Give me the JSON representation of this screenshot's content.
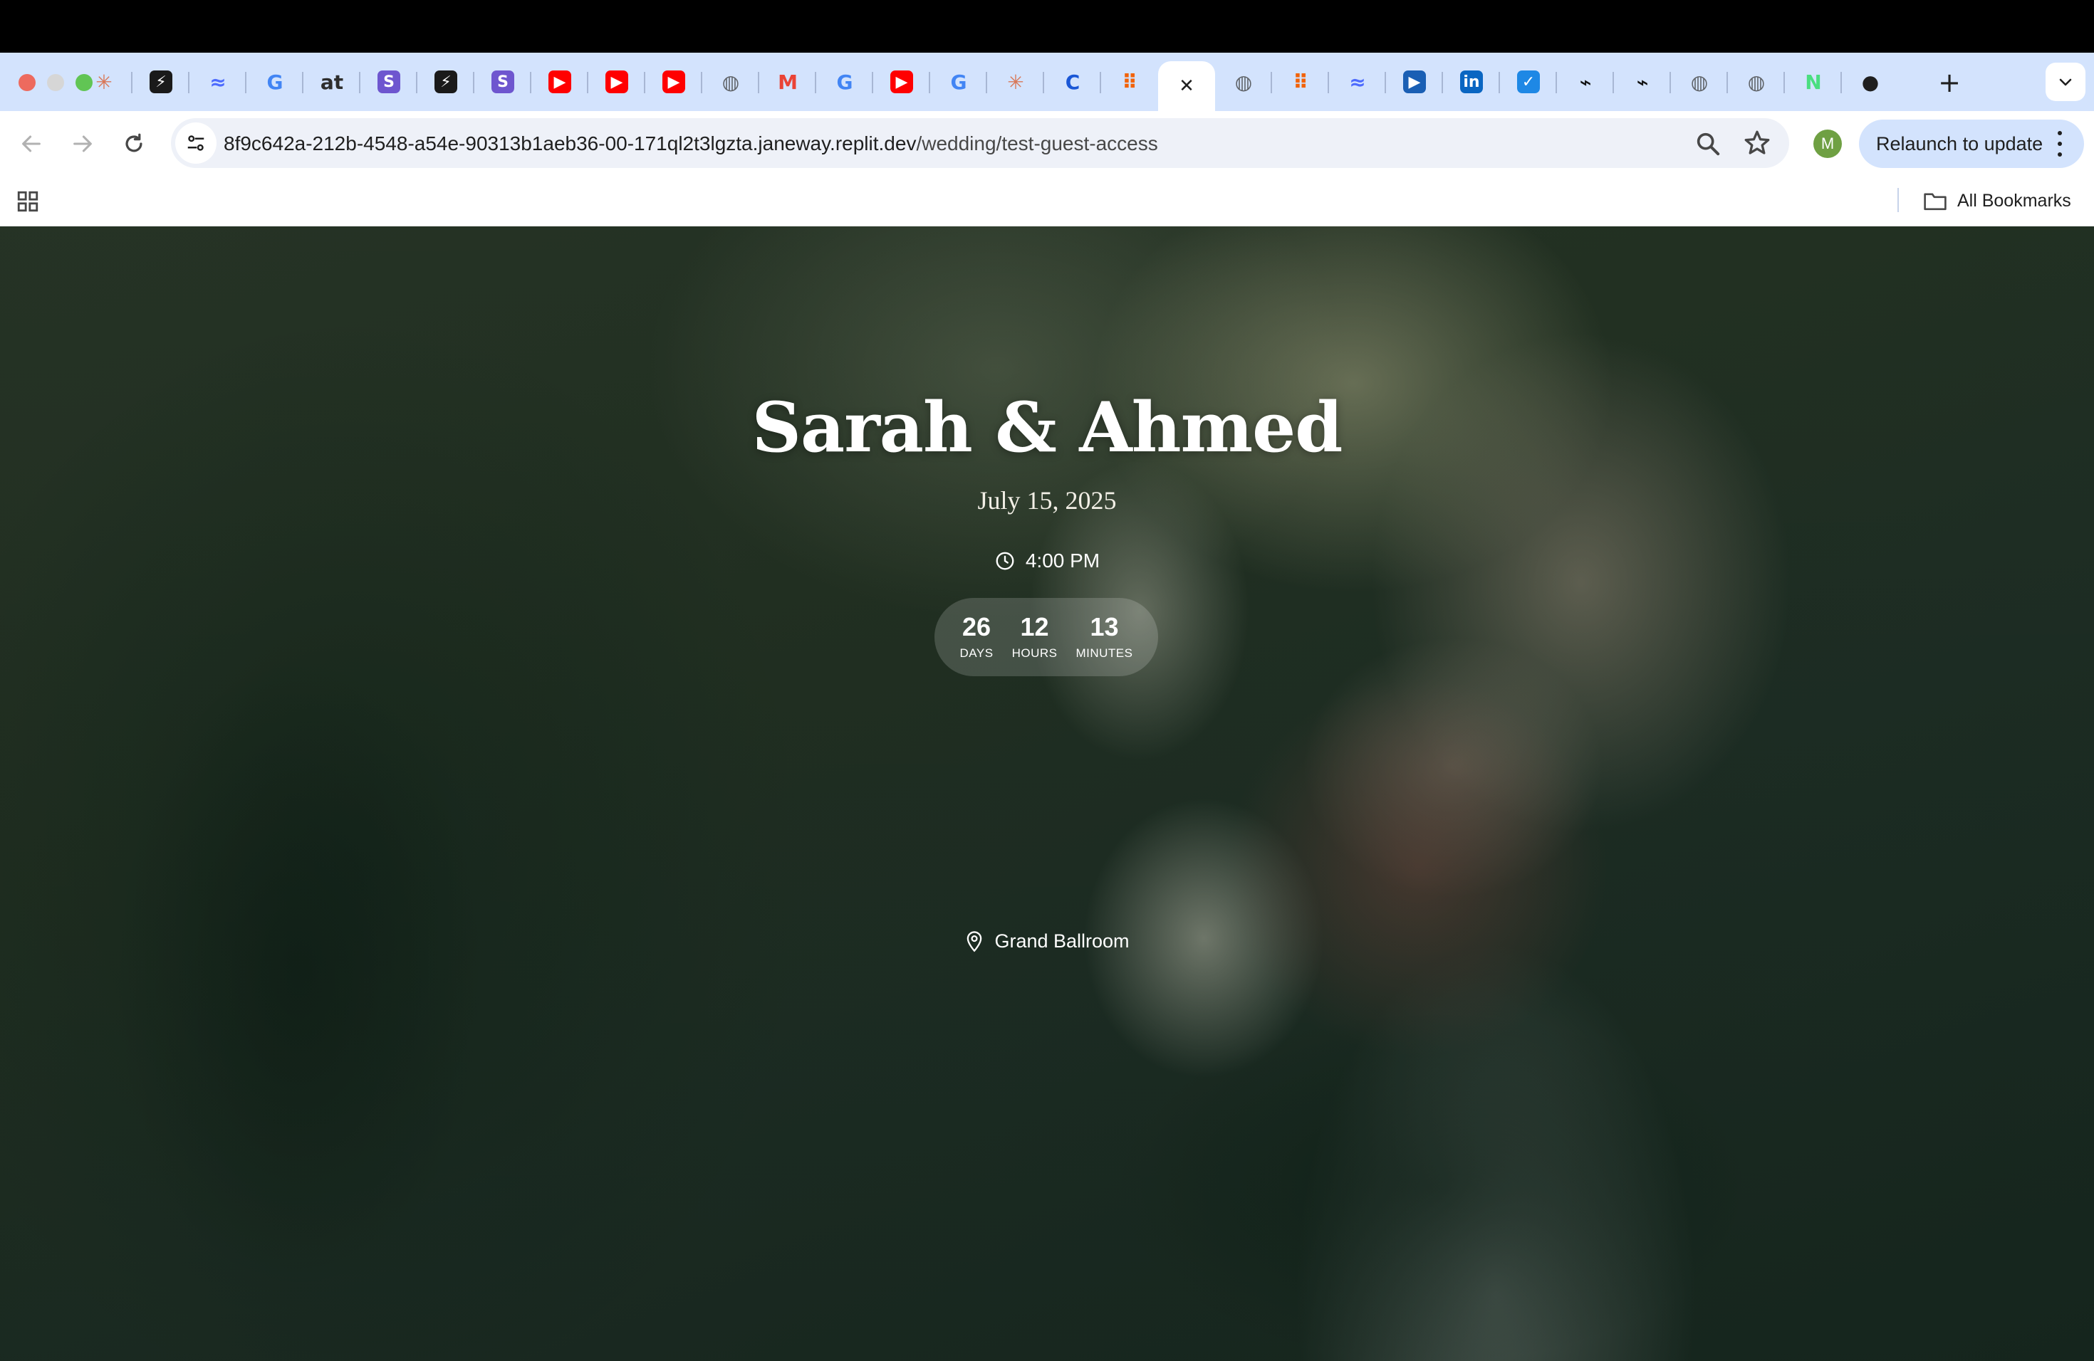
{
  "browser": {
    "tabs": [
      {
        "icon": "claude-icon",
        "color": "#d97757",
        "glyph": "✳"
      },
      {
        "icon": "bolt-icon",
        "color": "#1a1a1a",
        "glyph": "⚡"
      },
      {
        "icon": "deepseek-icon",
        "color": "#4d6bfe",
        "glyph": "≈"
      },
      {
        "icon": "google-icon",
        "color": "#4285f4",
        "glyph": "G"
      },
      {
        "icon": "at-icon",
        "color": "#2d2d2d",
        "glyph": "at"
      },
      {
        "icon": "s-icon",
        "color": "#6e56cf",
        "glyph": "S"
      },
      {
        "icon": "bolt-icon",
        "color": "#1a1a1a",
        "glyph": "⚡"
      },
      {
        "icon": "s-icon",
        "color": "#6e56cf",
        "glyph": "S"
      },
      {
        "icon": "youtube-icon",
        "color": "#ff0000",
        "glyph": "▶"
      },
      {
        "icon": "youtube-icon",
        "color": "#ff0000",
        "glyph": "▶"
      },
      {
        "icon": "youtube-icon",
        "color": "#ff0000",
        "glyph": "▶"
      },
      {
        "icon": "globe-icon",
        "color": "#5f6368",
        "glyph": "◍"
      },
      {
        "icon": "gmail-icon",
        "color": "#ea4335",
        "glyph": "M"
      },
      {
        "icon": "google-icon",
        "color": "#4285f4",
        "glyph": "G"
      },
      {
        "icon": "youtube-icon",
        "color": "#ff0000",
        "glyph": "▶"
      },
      {
        "icon": "google-icon",
        "color": "#4285f4",
        "glyph": "G"
      },
      {
        "icon": "claude-icon",
        "color": "#d97757",
        "glyph": "✳"
      },
      {
        "icon": "c-icon",
        "color": "#1a57d6",
        "glyph": "C"
      },
      {
        "icon": "replit-icon",
        "color": "#f26207",
        "glyph": "⠿"
      },
      {
        "icon": "close-icon",
        "color": "#1f1f1f",
        "glyph": "✕",
        "active": true
      },
      {
        "icon": "globe-icon",
        "color": "#5f6368",
        "glyph": "◍"
      },
      {
        "icon": "replit-icon",
        "color": "#f26207",
        "glyph": "⠿"
      },
      {
        "icon": "deepseek-icon",
        "color": "#4d6bfe",
        "glyph": "≈"
      },
      {
        "icon": "video-icon",
        "color": "#1a5fb4",
        "glyph": "▶"
      },
      {
        "icon": "linkedin-icon",
        "color": "#0a66c2",
        "glyph": "in"
      },
      {
        "icon": "tasks-icon",
        "color": "#1e88e5",
        "glyph": "✓"
      },
      {
        "icon": "pipe-icon",
        "color": "#111111",
        "glyph": "⌁"
      },
      {
        "icon": "pipe-check-icon",
        "color": "#111111",
        "glyph": "⌁"
      },
      {
        "icon": "globe-icon",
        "color": "#5f6368",
        "glyph": "◍"
      },
      {
        "icon": "globe-icon",
        "color": "#5f6368",
        "glyph": "◍"
      },
      {
        "icon": "n-icon",
        "color": "#4ade80",
        "glyph": "N"
      },
      {
        "icon": "github-icon",
        "color": "#1f1f1f",
        "glyph": "●"
      }
    ],
    "new_tab": "+",
    "url_host": "8f9c642a-212b-4548-a54e-90313b1aeb36-00-171ql2t3lgzta.janeway.replit.dev",
    "url_path": "/wedding/test-guest-access",
    "profile_initial": "M",
    "relaunch_label": "Relaunch to update",
    "all_bookmarks_label": "All Bookmarks"
  },
  "wedding": {
    "names": "Sarah & Ahmed",
    "date": "July 15, 2025",
    "time": "4:00 PM",
    "countdown": {
      "days": "26",
      "days_label": "DAYS",
      "hours": "12",
      "hours_label": "HOURS",
      "minutes": "13",
      "minutes_label": "MINUTES"
    },
    "venue": "Grand Ballroom"
  }
}
